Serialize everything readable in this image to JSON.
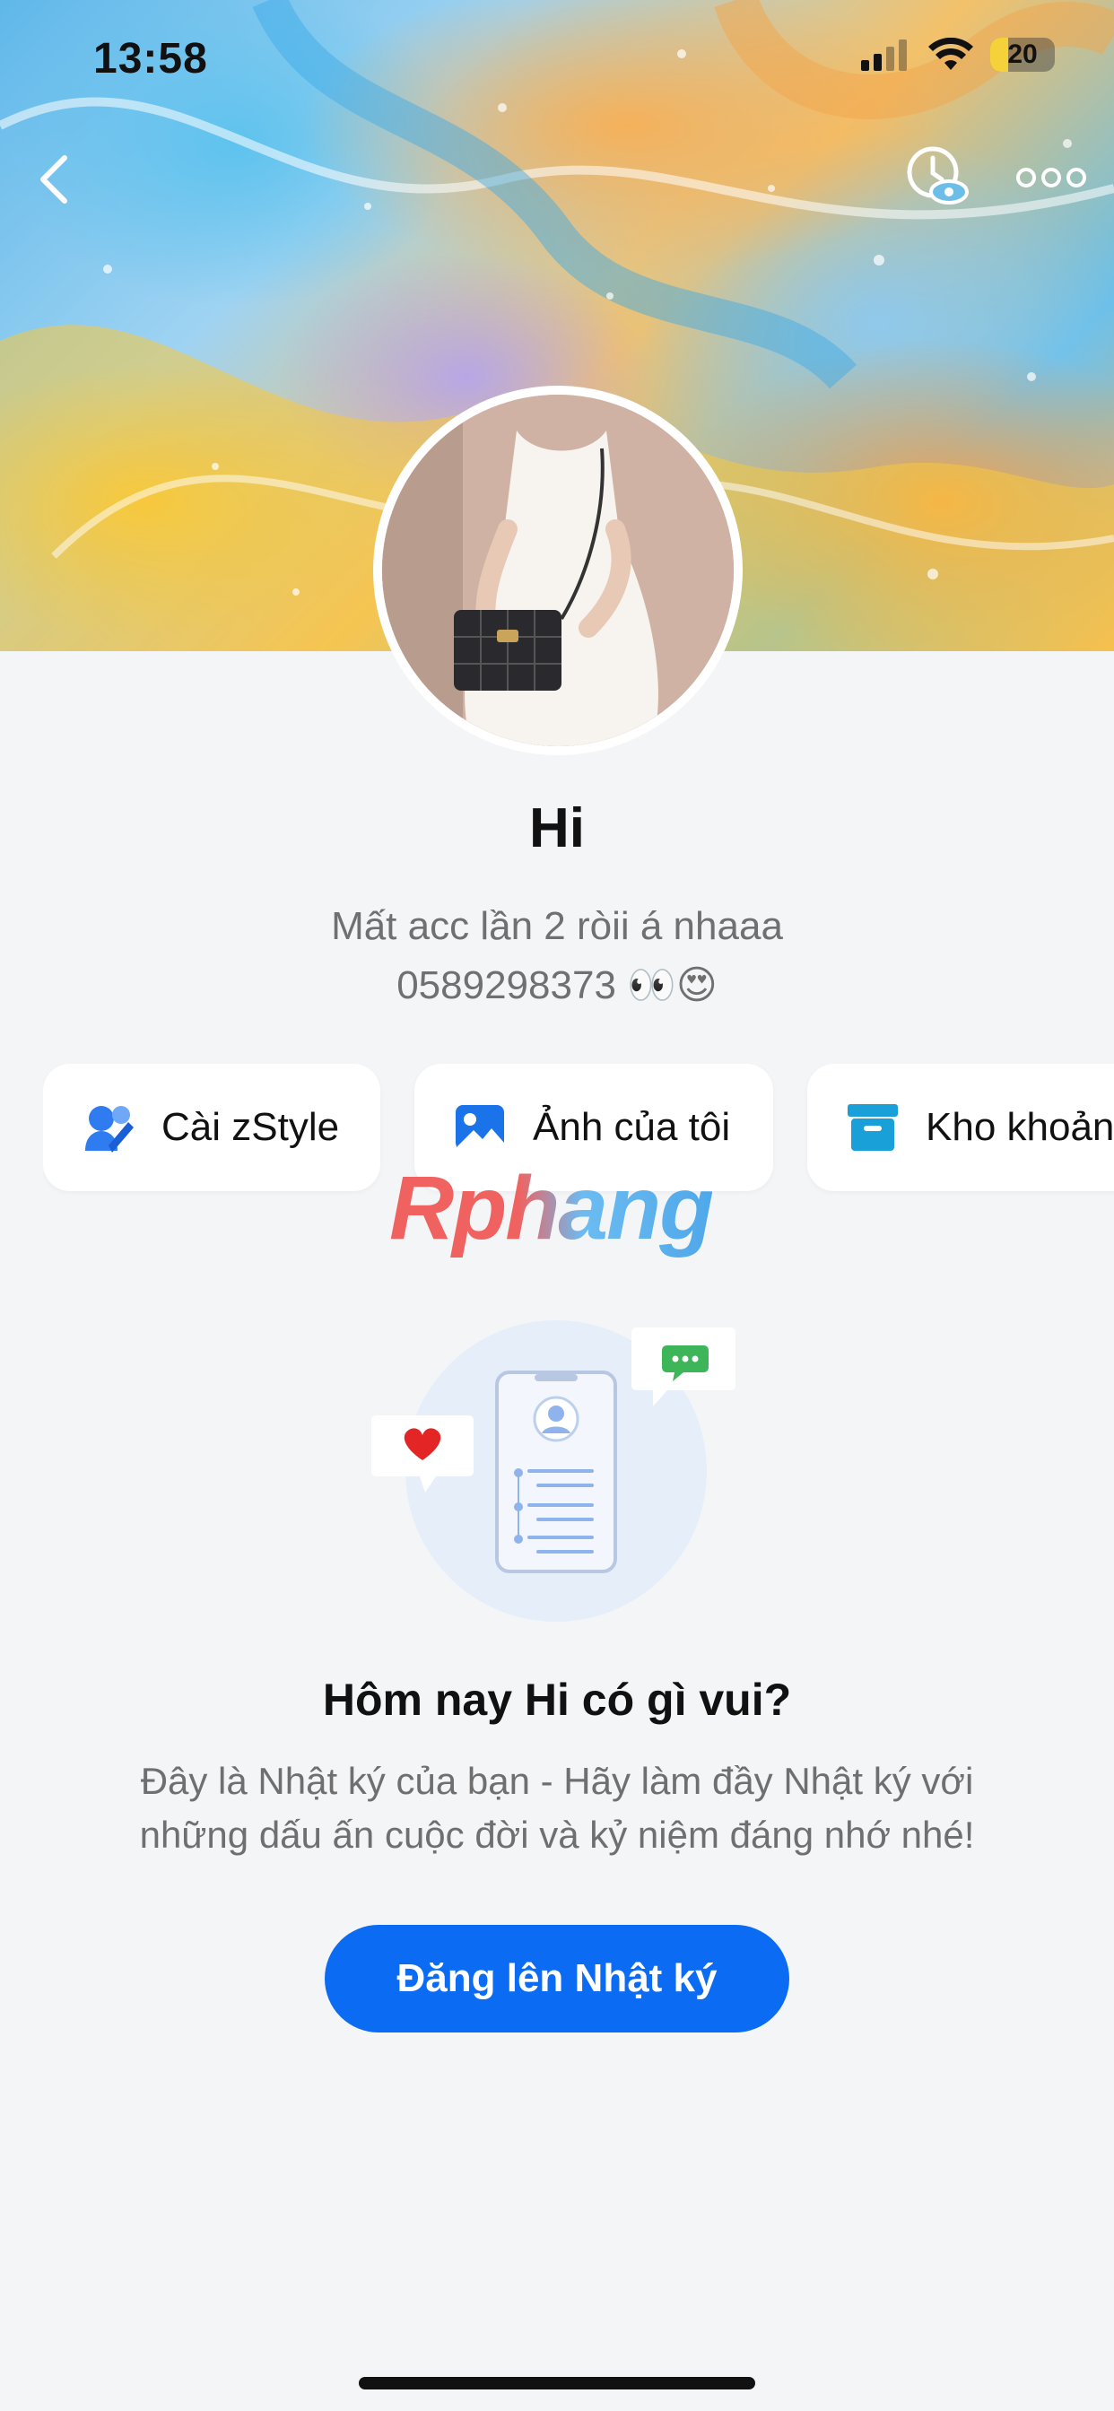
{
  "status_bar": {
    "time": "13:58",
    "battery": "20"
  },
  "profile": {
    "name": "Hi",
    "bio_line1": "Mất acc lần 2 ròii á nhaaa",
    "bio_line2": "0589298373 👀😍"
  },
  "quick_actions": [
    {
      "label": "Cài zStyle",
      "icon": "zstyle-icon"
    },
    {
      "label": "Ảnh của tôi",
      "icon": "photo-icon"
    },
    {
      "label": "Kho khoản",
      "icon": "archive-box-icon"
    }
  ],
  "watermark": "Rphang",
  "empty_state": {
    "title": "Hôm nay Hi có gì vui?",
    "description": "Đây là Nhật ký của bạn - Hãy làm đầy Nhật ký với những dấu ấn cuộc đời và kỷ niệm đáng nhớ nhé!",
    "button_label": "Đăng lên Nhật ký"
  },
  "colors": {
    "accent": "#0b6cf3",
    "background": "#f4f5f7"
  }
}
